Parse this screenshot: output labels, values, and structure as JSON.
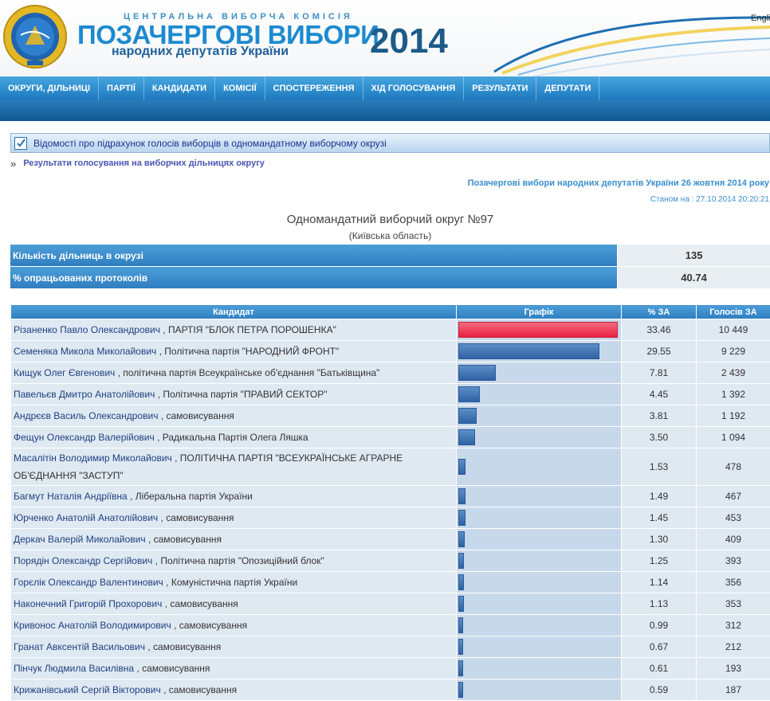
{
  "header": {
    "commission": "ЦЕНТРАЛЬНА ВИБОРЧА КОМІСІЯ",
    "title": "ПОЗАЧЕРГОВІ ВИБОРИ",
    "subtitle": "народних депутатів України",
    "year": "2014",
    "lang_link": "Engli"
  },
  "nav": {
    "items": [
      "ОКРУГИ, ДІЛЬНИЦІ",
      "ПАРТІЇ",
      "КАНДИДАТИ",
      "КОМІСІЇ",
      "СПОСТЕРЕЖЕННЯ",
      "ХІД ГОЛОСУВАННЯ",
      "РЕЗУЛЬТАТИ",
      "ДЕПУТАТИ"
    ]
  },
  "section": {
    "title": "Відомості про підрахунок голосів виборців в одномандатному виборчому окрузі",
    "raquo": "»",
    "sub_link": "Результати голосування на виборчих дільницях округу"
  },
  "election": {
    "title": "Позачергові вибори народних депутатів України 26 жовтня 2014 року",
    "as_of_label": "Станом на :",
    "as_of_value": "27.10.2014 20:20:21"
  },
  "district": {
    "title": "Одномандатний виборчий округ №97",
    "region": "(Київська область)"
  },
  "summary": [
    {
      "label": "Кількість дільниць в окрузі",
      "value": "135"
    },
    {
      "label": "% опрацьованих протоколів",
      "value": "40.74"
    }
  ],
  "table": {
    "headers": [
      "Кандидат",
      "Графік",
      "% ЗА",
      "Голосів ЗА"
    ],
    "max_percent": 33.46,
    "rows": [
      {
        "name": "Різаненко Павло Олександрович",
        "party": ", ПАРТІЯ \"БЛОК ПЕТРА ПОРОШЕНКА\"",
        "percent": "33.46",
        "votes": "10 449"
      },
      {
        "name": "Семеняка Микола Миколайович",
        "party": ", Політична партія \"НАРОДНИЙ ФРОНТ\"",
        "percent": "29.55",
        "votes": "9 229"
      },
      {
        "name": "Кищук Олег Євгенович",
        "party": ", політична партія Всеукраїнське об'єднання \"Батьківщина\"",
        "percent": "7.81",
        "votes": "2 439"
      },
      {
        "name": "Павельєв Дмитро Анатолійович",
        "party": ", Політична партія \"ПРАВИЙ СЕКТОР\"",
        "percent": "4.45",
        "votes": "1 392"
      },
      {
        "name": "Андрєєв Василь Олександрович",
        "party": ", самовисування",
        "percent": "3.81",
        "votes": "1 192"
      },
      {
        "name": "Фещун Олександр Валерійович",
        "party": ", Радикальна Партія Олега Ляшка",
        "percent": "3.50",
        "votes": "1 094"
      },
      {
        "name": "Масалітін Володимир Миколайович",
        "party": ", ПОЛІТИЧНА ПАРТІЯ \"ВСЕУКРАЇНСЬКЕ АГРАРНЕ ОБ'ЄДНАННЯ \"ЗАСТУП\"",
        "percent": "1.53",
        "votes": "478"
      },
      {
        "name": "Багмут Наталія Андріївна",
        "party": ", Ліберальна партія України",
        "percent": "1.49",
        "votes": "467"
      },
      {
        "name": "Юрченко Анатолій Анатолійович",
        "party": ", самовисування",
        "percent": "1.45",
        "votes": "453"
      },
      {
        "name": "Деркач Валерій Миколайович",
        "party": ", самовисування",
        "percent": "1.30",
        "votes": "409"
      },
      {
        "name": "Порядін Олександр Сергійович",
        "party": ", Політична партія \"Опозиційний блок\"",
        "percent": "1.25",
        "votes": "393"
      },
      {
        "name": "Горєлік Олександр Валентинович",
        "party": ", Комуністична партія України",
        "percent": "1.14",
        "votes": "356"
      },
      {
        "name": "Наконечний Григорій Прохорович",
        "party": ", самовисування",
        "percent": "1.13",
        "votes": "353"
      },
      {
        "name": "Кривонос Анатолій Володимирович",
        "party": ", самовисування",
        "percent": "0.99",
        "votes": "312"
      },
      {
        "name": "Гранат Авксентій Васильович",
        "party": ", самовисування",
        "percent": "0.67",
        "votes": "212"
      },
      {
        "name": "Пінчук Людмила Василівна",
        "party": ", самовисування",
        "percent": "0.61",
        "votes": "193"
      },
      {
        "name": "Крижанівський Сергій Вікторович",
        "party": ", самовисування",
        "percent": "0.59",
        "votes": "187"
      }
    ]
  }
}
